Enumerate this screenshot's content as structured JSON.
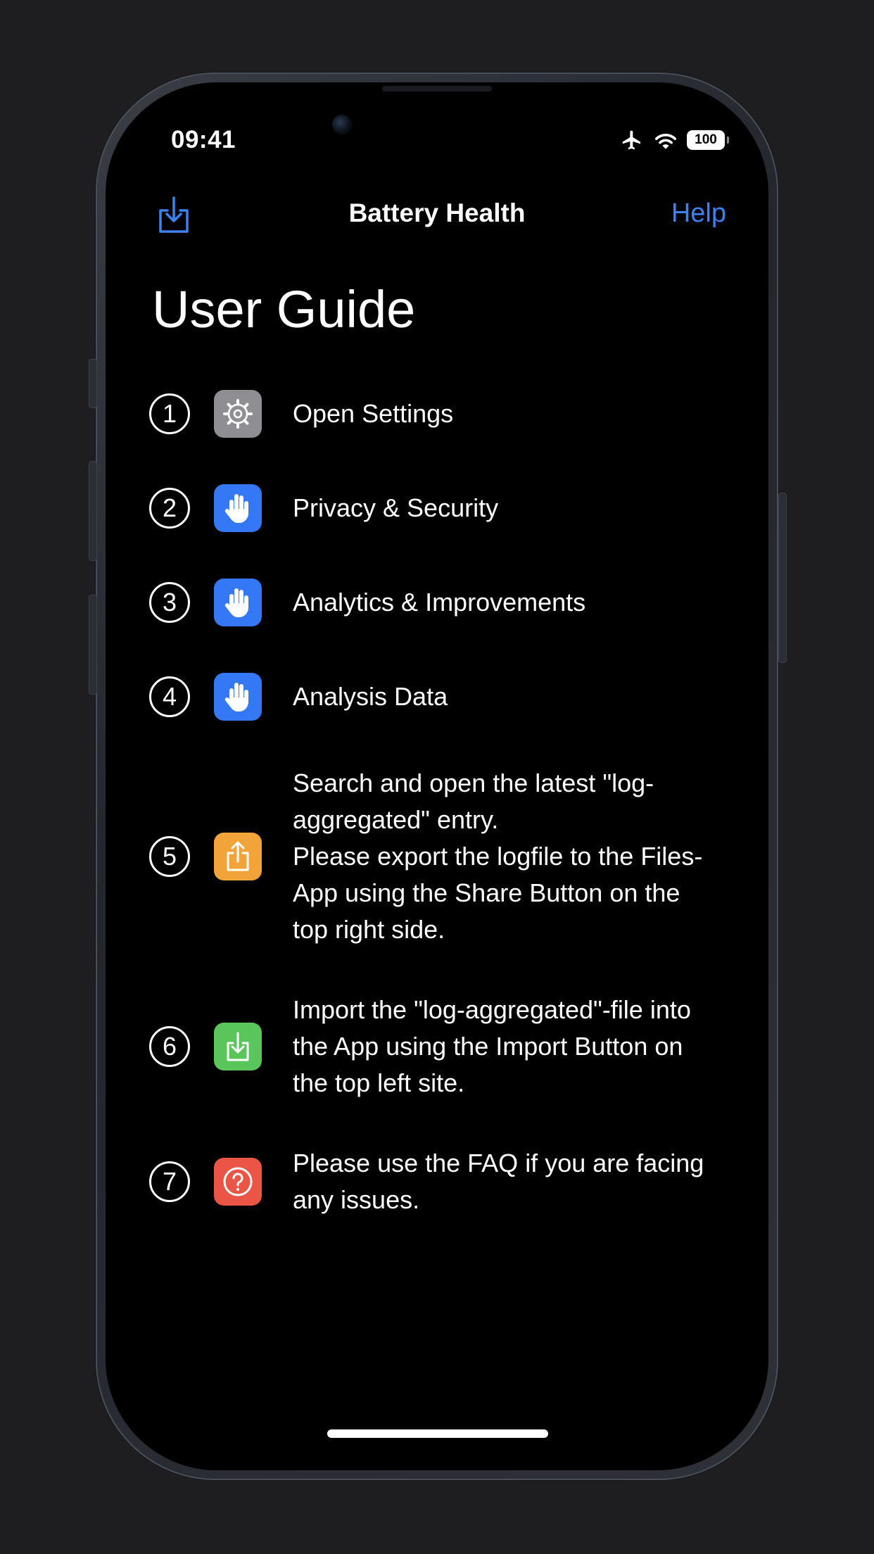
{
  "status_bar": {
    "time": "09:41",
    "battery": "100"
  },
  "nav": {
    "title": "Battery Health",
    "help_label": "Help"
  },
  "page": {
    "title": "User Guide"
  },
  "steps": [
    {
      "number": "1",
      "icon": "settings-gear-icon",
      "icon_color": "#8e8e93",
      "text": "Open Settings"
    },
    {
      "number": "2",
      "icon": "hand-raised-icon",
      "icon_color": "#3478f6",
      "text": "Privacy & Security"
    },
    {
      "number": "3",
      "icon": "hand-raised-icon",
      "icon_color": "#3478f6",
      "text": "Analytics & Improvements"
    },
    {
      "number": "4",
      "icon": "hand-raised-icon",
      "icon_color": "#3478f6",
      "text": "Analysis Data"
    },
    {
      "number": "5",
      "icon": "share-icon",
      "icon_color": "#f2a33a",
      "text": "Search and open the latest \"log-aggregated\" entry.\nPlease export the logfile to the Files-App using the Share Button on the top right side."
    },
    {
      "number": "6",
      "icon": "import-icon",
      "icon_color": "#5ac55a",
      "text": "Import the \"log-aggregated\"-file into the App using the Import Button on the top left site."
    },
    {
      "number": "7",
      "icon": "question-circle-icon",
      "icon_color": "#eb5545",
      "text": "Please use the FAQ if you are facing any issues."
    }
  ],
  "colors": {
    "accent": "#3b82f6",
    "background": "#000000"
  }
}
